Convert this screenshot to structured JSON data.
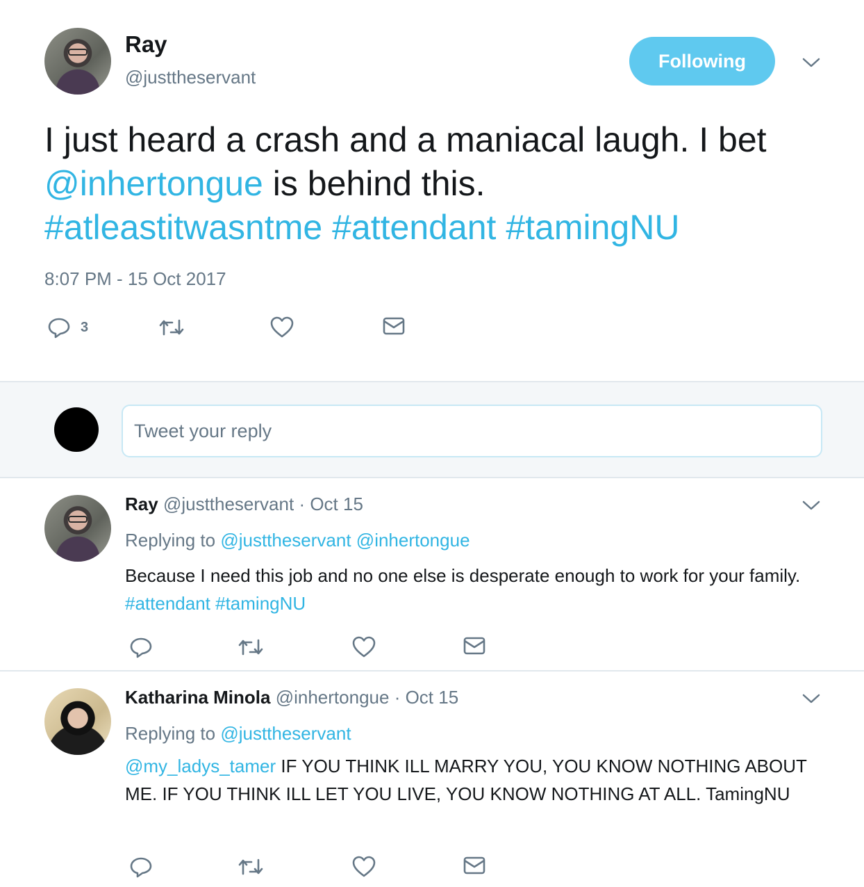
{
  "main_tweet": {
    "author_name": "Ray",
    "author_handle": "@justtheservant",
    "follow_label": "Following",
    "text": {
      "part1": "I just heard a crash and a maniacal laugh. I bet ",
      "mention": "@inhertongue",
      "part2": " is behind this.",
      "hashtag1": "#atleastitwasntme",
      "hashtag2": "#attendant",
      "hashtag3": "#tamingNU"
    },
    "timestamp": "8:07 PM - 15 Oct 2017",
    "reply_count": "3",
    "icons": [
      "reply-icon",
      "retweet-icon",
      "like-icon",
      "message-icon",
      "chevron-down-icon"
    ]
  },
  "composer": {
    "placeholder": "Tweet your reply"
  },
  "replies": [
    {
      "name": "Ray",
      "handle": "@justtheservant",
      "date": "· Oct 15",
      "replying_prefix": "Replying to",
      "replying_to": "@justtheservant @inhertongue",
      "body_text": "Because I need this job and no one else is desperate enough to work for your family. ",
      "hashtags": "#attendant #tamingNU"
    },
    {
      "name": "Katharina Minola",
      "handle": "@inhertongue",
      "date": "· Oct 15",
      "replying_prefix": "Replying to",
      "replying_to": "@justtheservant",
      "mention": "@my_ladys_tamer",
      "body_text": " IF YOU THINK ILL MARRY YOU, YOU KNOW NOTHING ABOUT ME. IF YOU THINK ILL LET YOU LIVE, YOU KNOW NOTHING AT ALL. TamingNU"
    }
  ],
  "colors": {
    "accent": "#31b5e3",
    "follow_button": "#5fc9ef",
    "muted_text": "#657786",
    "composer_bg": "#f4f7f9"
  }
}
